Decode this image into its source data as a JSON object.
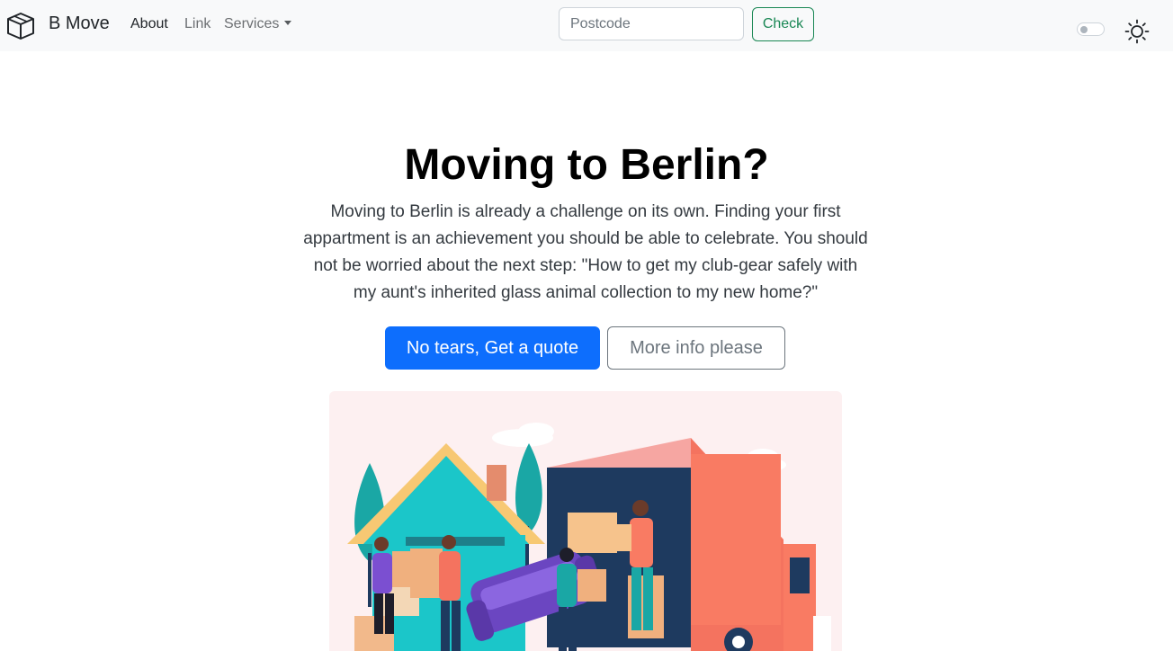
{
  "navbar": {
    "brand": "B Move",
    "links": [
      {
        "label": "About",
        "active": true
      },
      {
        "label": "Link",
        "active": false
      },
      {
        "label": "Services",
        "active": false
      }
    ],
    "search": {
      "placeholder": "Postcode",
      "value": ""
    },
    "check_label": "Check",
    "dark_mode_enabled": false
  },
  "hero": {
    "title": "Moving to Berlin?",
    "lead": "Moving to Berlin is already a challenge on its own. Finding your first appartment is an achievement you should be able to celebrate. You should not be worried about the next step: \"How to get my club-gear safely with my aunt's inherited glass animal collection to my new home?\"",
    "primary_button": "No tears, Get a quote",
    "secondary_button": "More info please"
  },
  "icons": {
    "brand": "box-icon",
    "theme": "sun-icon"
  },
  "colors": {
    "primary": "#0d6efd",
    "success": "#198754",
    "secondary": "#6c757d",
    "navbar_bg": "#f8f9fa",
    "illustration_bg": "#fdf0f1"
  }
}
